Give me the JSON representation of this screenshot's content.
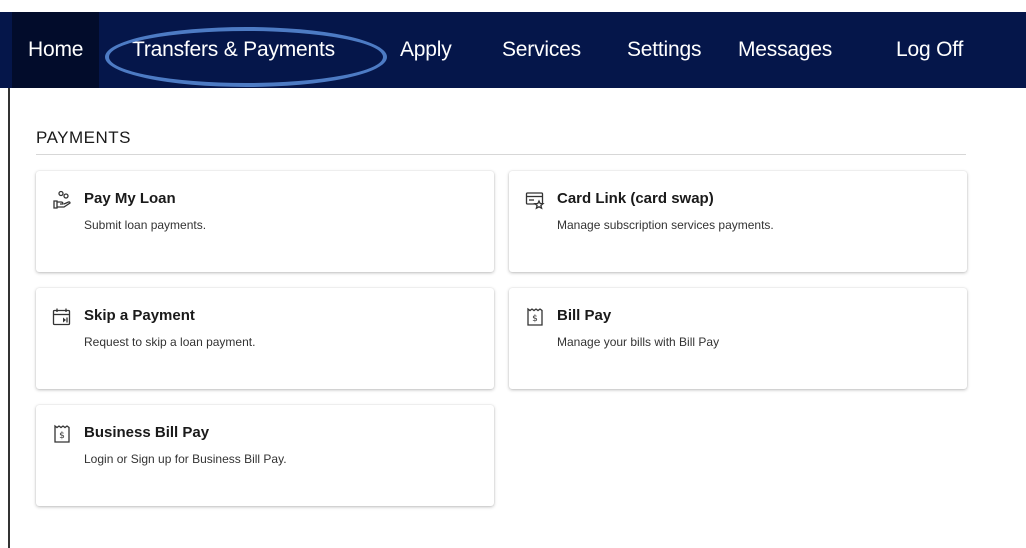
{
  "nav": {
    "items": [
      "Home",
      "Transfers & Payments",
      "Apply",
      "Services",
      "Settings",
      "Messages",
      "Log Off"
    ]
  },
  "section": {
    "title": "PAYMENTS"
  },
  "cards": [
    {
      "title": "Pay My Loan",
      "desc": "Submit loan payments.",
      "icon": "hand-coins-icon"
    },
    {
      "title": "Card Link (card swap)",
      "desc": "Manage subscription services payments.",
      "icon": "card-star-icon"
    },
    {
      "title": "Skip a Payment",
      "desc": "Request to skip a loan payment.",
      "icon": "calendar-skip-icon"
    },
    {
      "title": "Bill Pay",
      "desc": "Manage your bills with Bill Pay",
      "icon": "receipt-dollar-icon"
    },
    {
      "title": "Business Bill Pay",
      "desc": "Login or Sign up for Business Bill Pay.",
      "icon": "receipt-dollar-icon"
    }
  ],
  "colors": {
    "navbar": "#05164a",
    "nav_active": "#020c2b",
    "highlight": "#4d7bc4"
  }
}
